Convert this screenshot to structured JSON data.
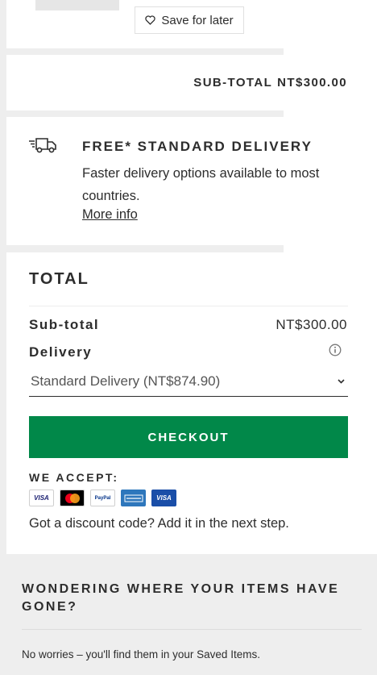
{
  "item": {
    "save_for_later": "Save for later"
  },
  "subtotal_bar": {
    "label": "SUB-TOTAL",
    "value": "NT$300.00"
  },
  "delivery_promo": {
    "icon": "truck-icon",
    "title": "FREE* STANDARD DELIVERY",
    "text": "Faster delivery options available to most countries.",
    "link": "More info"
  },
  "total": {
    "title": "TOTAL",
    "subtotal_label": "Sub-total",
    "subtotal_value": "NT$300.00",
    "delivery_label": "Delivery",
    "delivery_select": "Standard Delivery (NT$874.90)",
    "checkout": "CHECKOUT",
    "checkout_color": "#018849",
    "we_accept": "WE ACCEPT:",
    "payment_methods": [
      "visa-icon",
      "mastercard-icon",
      "paypal-icon",
      "amex-icon",
      "visa-debit-icon"
    ],
    "payment_labels": {
      "visa": "VISA",
      "paypal": "PayPal",
      "visa_debit": "VISA"
    },
    "discount_text": "Got a discount code? Add it in the next step."
  },
  "saved_items": {
    "title": "WONDERING WHERE YOUR ITEMS HAVE GONE?",
    "text": "No worries – you'll find them in your Saved Items."
  }
}
